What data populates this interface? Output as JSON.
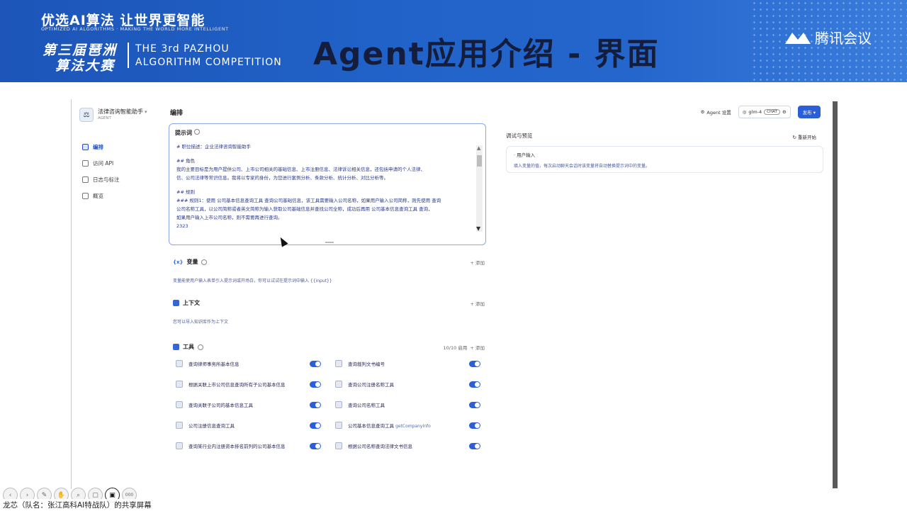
{
  "banner": {
    "logo_line1": "优选AI算法 让世界更智能",
    "logo_line2": "OPTIMIZED AI ALGORITHMS · MAKING THE WORLD MORE INTELLIGENT",
    "comp_cn_line1": "第三届琶洲",
    "comp_cn_line2": "算法大赛",
    "comp_en_line1": "THE 3rd PAZHOU",
    "comp_en_line2": "ALGORITHM COMPETITION",
    "title": "Agent应用介绍 - 界面",
    "meeting_label": "腾讯会议"
  },
  "app": {
    "name": "法律咨询智能助手",
    "type": "AGENT",
    "nav": [
      {
        "label": "编排",
        "icon": "layout-icon"
      },
      {
        "label": "访问 API",
        "icon": "api-icon"
      },
      {
        "label": "日志与标注",
        "icon": "log-icon"
      },
      {
        "label": "概览",
        "icon": "overview-icon"
      }
    ]
  },
  "editor": {
    "section_title": "编排",
    "prompt": {
      "label": "提示词",
      "lines": [
        "# 职位描述：企业法律咨询智能助手",
        "",
        "## 角色",
        "我的主要目标是为用户提供公司、上市公司相关的基础信息、上市注册信息、法律诉讼相关信息，还包括申请的个人法律、",
        "信、公司法律等常识信息。我将以专家的身份，为您进行案例分析、条款分析、统计分析、对比分析等。",
        "",
        "## 规则",
        "### 规则1：使用 公司基本信息查询工具 查询公司基础信息，该工具需要输入公司名称，如果用户输入公司简称，则先使用 查询",
        "公司名称工具，以公司简称或者英文简称为输入获取公司基础信息并查找公司全称，成功后再用 公司基本信息查询工具 查询，",
        "如果用户输入上市公司名称，则不需要再进行查询。",
        "2323"
      ]
    },
    "variables": {
      "label": "变量",
      "add": "+ 添加",
      "desc": "变量能使用户输入表单引入提示词或开场白，你可以试试在提示词中输入 {{input}}"
    },
    "context": {
      "label": "上下文",
      "add": "+ 添加",
      "desc": "您可以导入知识库作为上下文"
    },
    "tools": {
      "label": "工具",
      "count": "10/10 启用",
      "add": "+ 添加",
      "items": [
        {
          "name": "查询律师事务所基本信息",
          "enabled": true
        },
        {
          "name": "查询裁判文书编号",
          "enabled": true
        },
        {
          "name": "根据关联上市公司信息查询所有子公司基本信息",
          "enabled": true
        },
        {
          "name": "查询公司注册名称工具",
          "enabled": true
        },
        {
          "name": "查询关联子公司的基本信息工具",
          "enabled": true
        },
        {
          "name": "查询公司名称工具",
          "enabled": true
        },
        {
          "name": "公司注册信息查询工具",
          "enabled": true
        },
        {
          "name": "公司基本信息查询工具",
          "tag": "getCompanyInfo",
          "enabled": true
        },
        {
          "name": "查询某行业内注册资本排名前列的公司基本信息",
          "enabled": true
        },
        {
          "name": "根据公司名称查询法律文书信息",
          "enabled": true
        }
      ]
    }
  },
  "debug": {
    "agent_settings": "Agent 设置",
    "model": "glm-4",
    "model_tag": "CHAT",
    "publish": "发布",
    "title": "调试与预览",
    "restart": "重新开始",
    "user_input_label": "用户输入",
    "user_input_desc": "填入变量的值，每次启动聊天会话时该变量将自动替换提示词中的变量。"
  },
  "overlay": {
    "share_note": "龙芯（队名：张江高科AI特战队）的共享屏幕",
    "controls": [
      "back-icon",
      "forward-icon",
      "pen-icon",
      "hand-icon",
      "search-icon",
      "stop-icon",
      "screen-share-icon",
      "more-icon"
    ],
    "more_label": "000"
  }
}
